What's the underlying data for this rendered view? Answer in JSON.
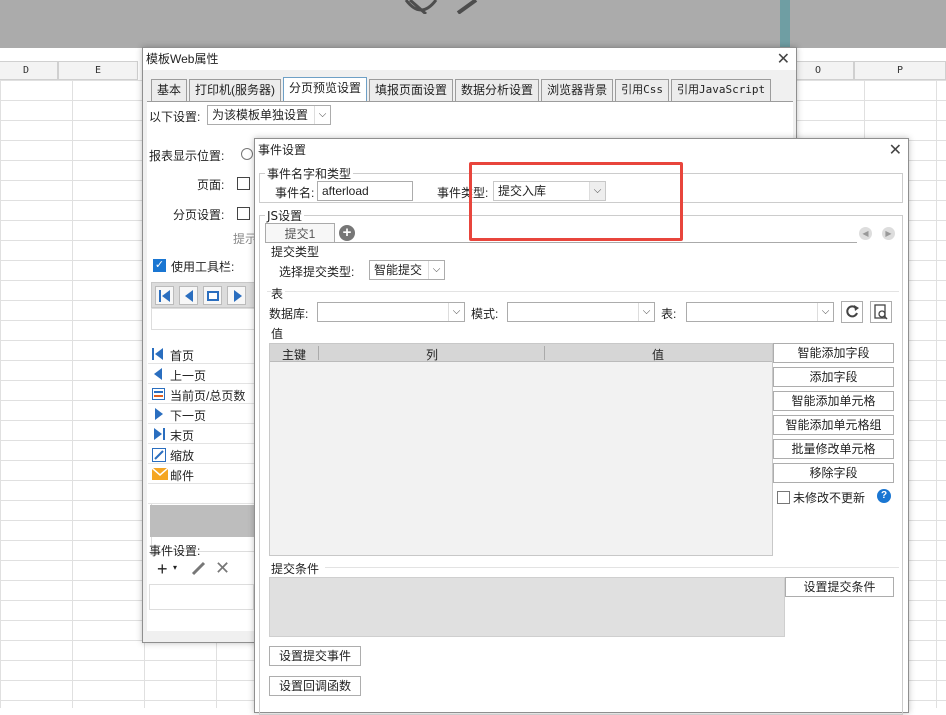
{
  "spreadsheet": {
    "columns": [
      {
        "label": "D"
      },
      {
        "label": "E"
      },
      {
        "label": "O"
      },
      {
        "label": "P"
      }
    ]
  },
  "back_dialog": {
    "title": "模板Web属性",
    "tabs": [
      "基本",
      "打印机(服务器)",
      "分页预览设置",
      "填报页面设置",
      "数据分析设置",
      "浏览器背景",
      "引用Css",
      "引用JavaScript"
    ],
    "active_tab_index": 2,
    "setting_label": "以下设置:",
    "setting_value": "为该模板单独设置",
    "report_position_label": "报表显示位置:",
    "page_label": "页面:",
    "paging_label": "分页设置:",
    "hint_fragment": "提示",
    "use_toolbar_label": "使用工具栏:",
    "toolbar_items": [
      {
        "label": "首页",
        "icon": "first-page-icon"
      },
      {
        "label": "上一页",
        "icon": "prev-page-icon"
      },
      {
        "label": "当前页/总页数",
        "icon": "page-count-icon"
      },
      {
        "label": "下一页",
        "icon": "next-page-icon"
      },
      {
        "label": "末页",
        "icon": "last-page-icon"
      },
      {
        "label": "缩放",
        "icon": "zoom-icon"
      },
      {
        "label": "邮件",
        "icon": "mail-icon"
      }
    ],
    "event_settings_label": "事件设置:"
  },
  "event_dialog": {
    "title": "事件设置",
    "name_type_group": "事件名字和类型",
    "event_name_label": "事件名:",
    "event_name_value": "afterload",
    "event_type_label": "事件类型:",
    "event_type_value": "提交入库",
    "js_group": "JS设置",
    "submit_tab": "提交1",
    "submit_type_group": "提交类型",
    "select_submit_type_label": "选择提交类型:",
    "submit_type_value": "智能提交",
    "table_group": "表",
    "database_label": "数据库:",
    "schema_label": "模式:",
    "table_label": "表:",
    "value_group": "值",
    "columns": [
      "主键",
      "列",
      "值"
    ],
    "side_buttons": [
      "智能添加字段",
      "添加字段",
      "智能添加单元格",
      "智能添加单元格组",
      "批量修改单元格",
      "移除字段"
    ],
    "no_update_label": "未修改不更新",
    "submit_condition_group": "提交条件",
    "set_condition_button": "设置提交条件",
    "set_submit_event_button": "设置提交事件",
    "set_callback_button": "设置回调函数"
  },
  "colors": {
    "highlight_box": "#e8453c",
    "accent_blue": "#2a6ebf",
    "help_icon": "#1a76d2"
  }
}
